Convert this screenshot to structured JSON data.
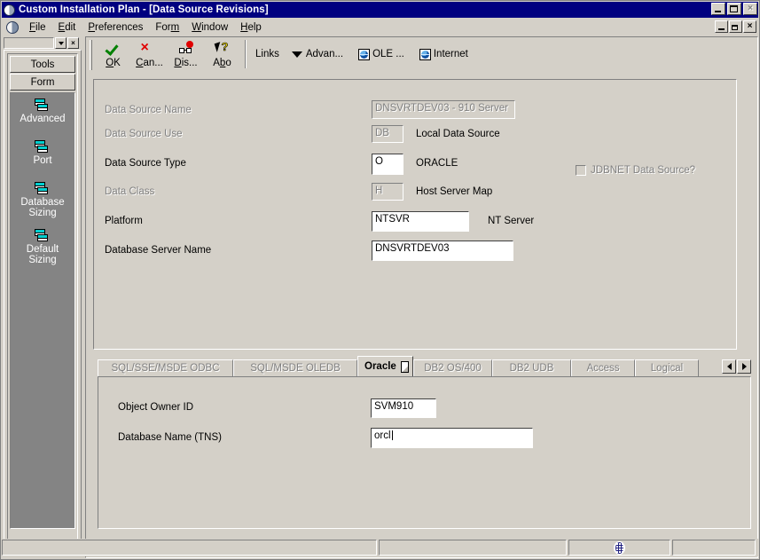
{
  "window": {
    "title": "Custom Installation Plan - [Data Source Revisions]",
    "min_label": "_",
    "max_label": "□",
    "close_label": "×"
  },
  "mdi": {
    "min_label": "_",
    "restore_label": "❐",
    "close_label": "×"
  },
  "menu": {
    "items": [
      {
        "pre": "",
        "acc": "F",
        "post": "ile"
      },
      {
        "pre": "",
        "acc": "E",
        "post": "dit"
      },
      {
        "pre": "",
        "acc": "P",
        "post": "references"
      },
      {
        "pre": "For",
        "acc": "m",
        "post": ""
      },
      {
        "pre": "",
        "acc": "W",
        "post": "indow"
      },
      {
        "pre": "",
        "acc": "H",
        "post": "elp"
      }
    ]
  },
  "dock": {
    "combo_value": "",
    "close_label": "×",
    "tabs": [
      {
        "label": "Tools"
      },
      {
        "label": "Form"
      }
    ],
    "items": [
      {
        "label": "Advanced",
        "icon": "form-window-icon"
      },
      {
        "label": "Port",
        "icon": "form-window-icon"
      },
      {
        "label": "Database Sizing",
        "line1": "Database",
        "line2": "Sizing",
        "icon": "form-window-icon"
      },
      {
        "label": "Default Sizing",
        "line1": "Default",
        "line2": "Sizing",
        "icon": "form-window-icon"
      }
    ]
  },
  "toolbar": {
    "buttons": [
      {
        "pre": "",
        "acc": "O",
        "post": "K",
        "icon": "green-check-icon"
      },
      {
        "pre": "",
        "acc": "C",
        "post": "an...",
        "icon": "red-x-icon"
      },
      {
        "pre": "",
        "acc": "D",
        "post": "is...",
        "icon": "glasses-icon"
      },
      {
        "pre": "A",
        "acc": "b",
        "post": "o",
        "icon": "cursor-question-icon"
      }
    ],
    "links_label": "Links",
    "advanced_label": "Advan...",
    "ole_label": "OLE ...",
    "internet_label": "Internet"
  },
  "form": {
    "fields": [
      {
        "label": "Data Source Name",
        "value": "DNSVRTDEV03 - 910 Server",
        "readonly": true,
        "label_disabled": true,
        "suffix": ""
      },
      {
        "label": "Data Source Use",
        "value": "DB",
        "readonly": true,
        "label_disabled": true,
        "suffix": "Local Data Source"
      },
      {
        "label": "Data Source Type",
        "value": "O",
        "readonly": false,
        "label_disabled": false,
        "suffix": "ORACLE"
      },
      {
        "label": "Data Class",
        "value": "H",
        "readonly": true,
        "label_disabled": true,
        "suffix": "Host Server Map"
      },
      {
        "label": "Platform",
        "value": "NTSVR",
        "readonly": false,
        "label_disabled": false,
        "suffix": "NT Server"
      },
      {
        "label": "Database Server Name",
        "value": "DNSVRTDEV03",
        "readonly": false,
        "label_disabled": false,
        "suffix": ""
      }
    ],
    "jdbnet_checkbox": {
      "label": "JDBNET Data Source?",
      "checked": false,
      "disabled": true
    }
  },
  "tabs": {
    "items": [
      {
        "label": "SQL/SSE/MSDE ODBC",
        "active": false
      },
      {
        "label": "SQL/MSDE OLEDB",
        "active": false
      },
      {
        "label": "Oracle",
        "active": true
      },
      {
        "label": "DB2 OS/400",
        "active": false
      },
      {
        "label": "DB2 UDB",
        "active": false
      },
      {
        "label": "Access",
        "active": false
      },
      {
        "label": "Logical",
        "active": false
      }
    ],
    "scroll_left": "◄",
    "scroll_right": "►"
  },
  "tabpage": {
    "fields": [
      {
        "label": "Object Owner ID",
        "value": "SVM910",
        "focused": false
      },
      {
        "label": "Database Name (TNS)",
        "value": "orcl",
        "focused": true
      }
    ]
  },
  "status": {
    "pane1": "",
    "pane2": "",
    "pane3": "",
    "globe_icon": "globe-icon"
  }
}
